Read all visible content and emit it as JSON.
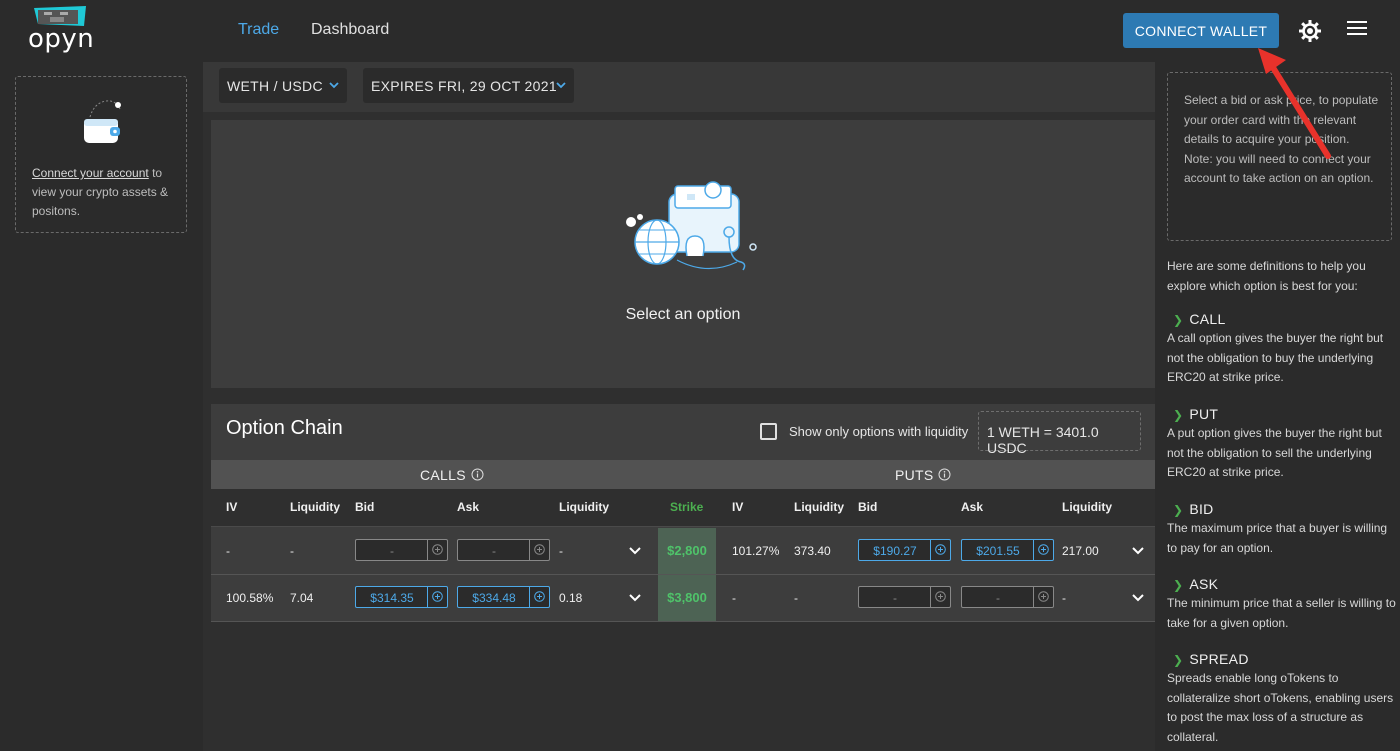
{
  "header": {
    "logo_text": "opyn",
    "nav": {
      "trade": "Trade",
      "dashboard": "Dashboard"
    },
    "connect_wallet": "CONNECT WALLET",
    "accent_color": "#4da9e8",
    "button_color": "#2d7ab3"
  },
  "left_sidebar": {
    "connect_link": "Connect your account",
    "connect_rest": " to view your crypto assets & positons."
  },
  "filters": {
    "pair": "WETH / USDC",
    "expiry": "EXPIRES FRI, 29 OCT 2021"
  },
  "select_panel": {
    "text": "Select an option"
  },
  "option_chain": {
    "title": "Option Chain",
    "liquidity_filter_label": "Show only options with liquidity",
    "liquidity_filter_checked": false,
    "price_ref": "1 WETH = 3401.0 USDC",
    "calls_label": "CALLS",
    "puts_label": "PUTS",
    "columns": {
      "iv": "IV",
      "liquidity": "Liquidity",
      "bid": "Bid",
      "ask": "Ask",
      "strike": "Strike"
    },
    "rows": [
      {
        "call_iv": "-",
        "call_liq": "-",
        "call_bid": "-",
        "call_ask": "-",
        "call_liq2": "-",
        "strike": "$2,800",
        "put_iv": "101.27%",
        "put_liq": "373.40",
        "put_bid": "$190.27",
        "put_ask": "$201.55",
        "put_liq2": "217.00"
      },
      {
        "call_iv": "100.58%",
        "call_liq": "7.04",
        "call_bid": "$314.35",
        "call_ask": "$334.48",
        "call_liq2": "0.18",
        "strike": "$3,800",
        "put_iv": "-",
        "put_liq": "-",
        "put_bid": "-",
        "put_ask": "-",
        "put_liq2": "-"
      }
    ]
  },
  "right_sidebar": {
    "hint": "Select a bid or ask price, to populate your order card with the relevant details to acquire your position.",
    "note": "Note: you will need to connect your account to take action on an option.",
    "intro": "Here are some definitions to help you explore which option is best for you:",
    "definitions": [
      {
        "term": "CALL",
        "text": "A call option gives the buyer the right but not the obligation to buy the underlying ERC20 at strike price."
      },
      {
        "term": "PUT",
        "text": "A put option gives the buyer the right but not the obligation to sell the underlying ERC20 at strike price."
      },
      {
        "term": "BID",
        "text": "The maximum price that a buyer is willing to pay for an option."
      },
      {
        "term": "ASK",
        "text": "The minimum price that a seller is willing to take for a given option."
      },
      {
        "term": "SPREAD",
        "text": "Spreads enable long oTokens to collateralize short oTokens, enabling users to post the max loss of a structure as collateral."
      }
    ]
  },
  "icons": [
    "gear-icon",
    "menu-icon",
    "wallet-icon",
    "chevron-down-icon",
    "info-icon",
    "plus-circle-icon",
    "arrow-right-icon"
  ],
  "colors": {
    "strike_green": "#4fc36a",
    "annotation_red": "#e8322b"
  }
}
